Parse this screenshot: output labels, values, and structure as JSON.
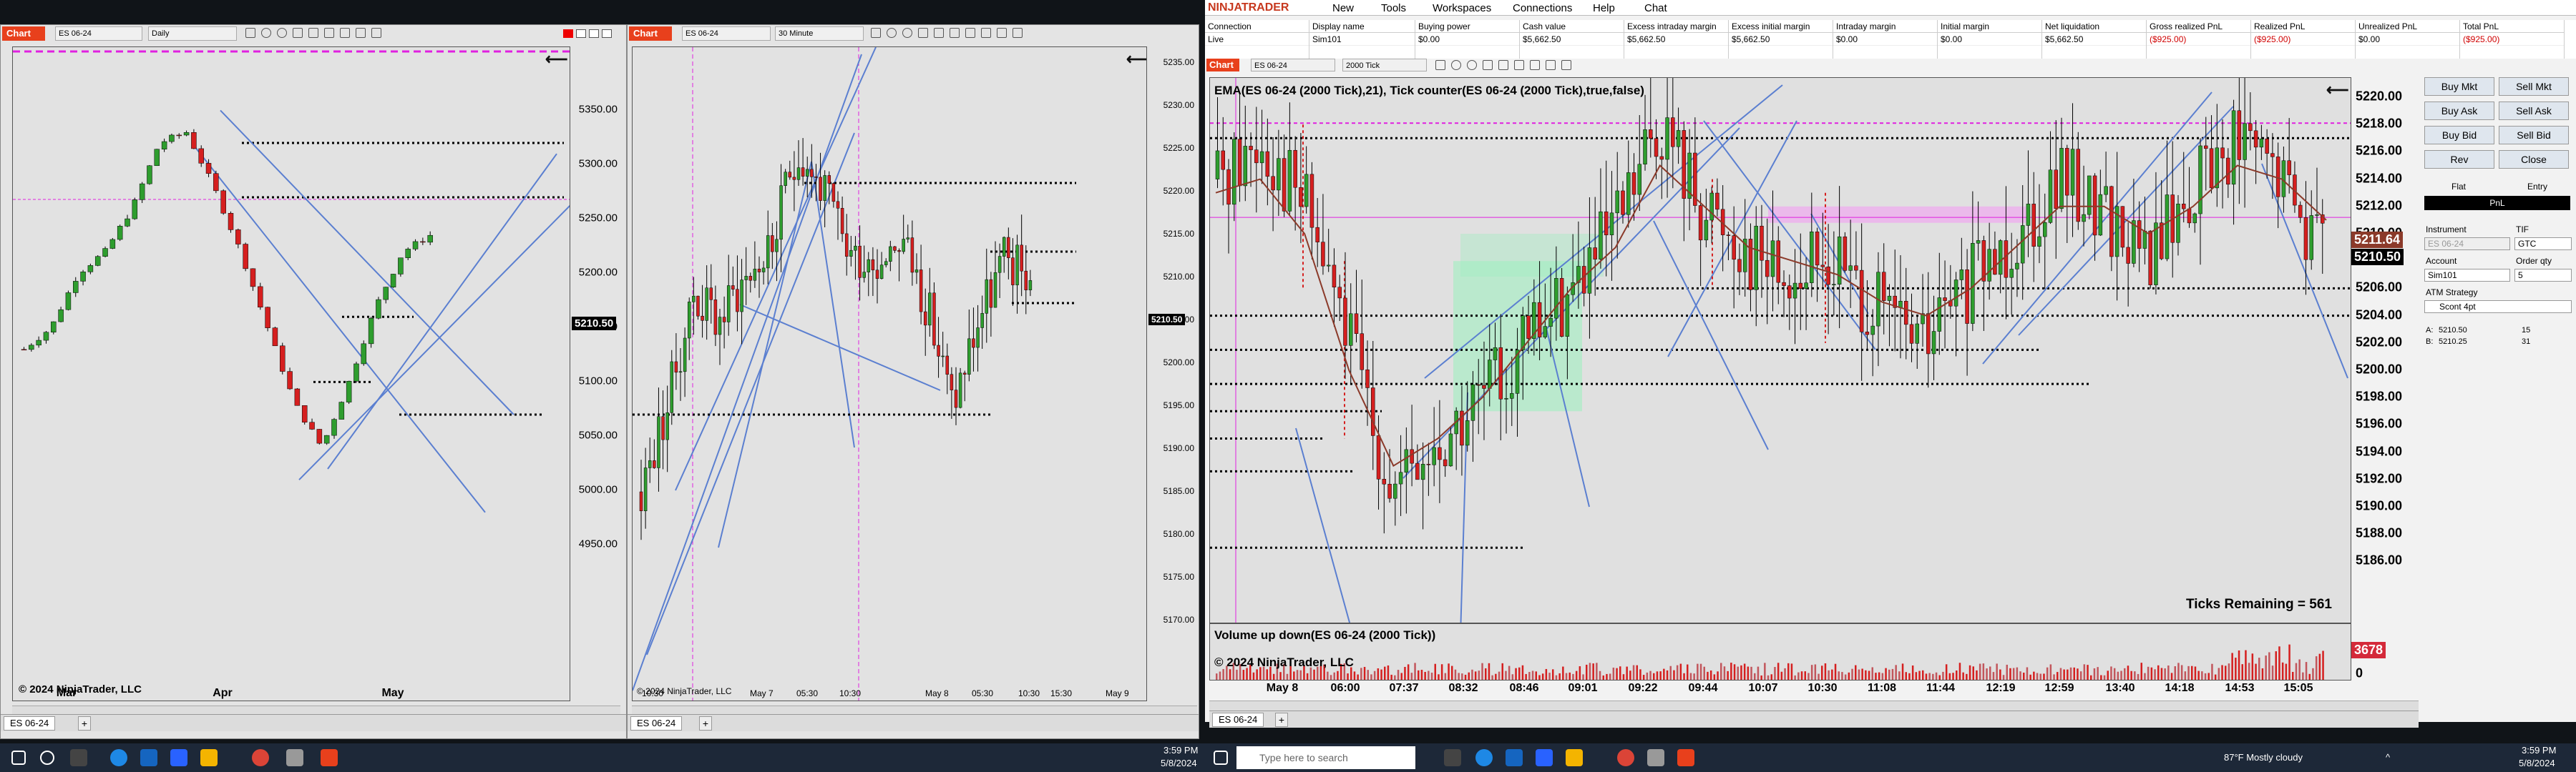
{
  "left_chart": {
    "tab": "Chart",
    "instrument": "ES 06-24",
    "period": "Daily",
    "yticks": [
      "5350.00",
      "5300.00",
      "5250.00",
      "5200.00",
      "5150.00",
      "5100.00",
      "5050.00",
      "5000.00",
      "4950.00"
    ],
    "price": "5210.50",
    "months": [
      "Mar",
      "Apr",
      "May"
    ],
    "copyright": "© 2024 NinjaTrader, LLC",
    "doc_tab": "ES 06-24"
  },
  "mid_chart": {
    "tab": "Chart",
    "instrument": "ES 06-24",
    "period": "30 Minute",
    "yticks": [
      "5235.00",
      "5230.00",
      "5225.00",
      "5220.00",
      "5215.00",
      "5210.00",
      "5205.00",
      "5200.00",
      "5195.00",
      "5190.00",
      "5185.00",
      "5180.00",
      "5175.00",
      "5170.00"
    ],
    "price": "5210.50",
    "xlabels": [
      "10:30",
      "May 7",
      "05:30",
      "10:30",
      "May 8",
      "05:30",
      "10:30",
      "15:30",
      "May 9"
    ],
    "copyright": "© 2024 NinjaTrader, LLC",
    "doc_tab": "ES 06-24"
  },
  "nt": {
    "brand": "NINJATRADER",
    "menu": [
      "New",
      "Tools",
      "Workspaces",
      "Connections",
      "Help",
      "Chat"
    ],
    "account_headers": [
      "Connection",
      "Display name",
      "Buying power",
      "Cash value",
      "Excess intraday margin",
      "Excess initial margin",
      "Intraday margin",
      "Initial margin",
      "Net liquidation",
      "Gross realized PnL",
      "Realized PnL",
      "Unrealized PnL",
      "Total PnL"
    ],
    "account_row": [
      "Live",
      "Sim101",
      "$0.00",
      "$5,662.50",
      "$5,662.50",
      "$5,662.50",
      "$0.00",
      "$0.00",
      "$5,662.50",
      "($925.00)",
      "($925.00)",
      "$0.00",
      "($925.00)"
    ],
    "chart_tab": "Chart",
    "instrument": "ES 06-24",
    "period": "2000 Tick",
    "indicator_title": "EMA(ES 06-24 (2000 Tick),21), Tick counter(ES 06-24 (2000 Tick),true,false)",
    "yticks": [
      "5220.00",
      "5218.00",
      "5216.00",
      "5214.00",
      "5212.00",
      "5210.00",
      "5208.00",
      "5206.00",
      "5204.00",
      "5202.00",
      "5200.00",
      "5198.00",
      "5196.00",
      "5194.00",
      "5192.00",
      "5190.00",
      "5188.00",
      "5186.00"
    ],
    "price_a": "5211.64",
    "price_b": "5210.50",
    "ticks_remaining": "Ticks Remaining = 561",
    "volume_title": "Volume up down(ES 06-24 (2000 Tick))",
    "copyright": "© 2024 NinjaTrader, LLC",
    "volume": "3678",
    "volume_zero": "0",
    "xlabels": [
      "May 8",
      "06:00",
      "07:37",
      "08:32",
      "08:46",
      "09:01",
      "09:22",
      "09:44",
      "10:07",
      "10:30",
      "11:08",
      "11:44",
      "12:19",
      "12:59",
      "13:40",
      "14:18",
      "14:53",
      "15:05"
    ],
    "doc_tab": "ES 06-24",
    "order": {
      "buy_mkt": "Buy Mkt",
      "sell_mkt": "Sell Mkt",
      "buy_ask": "Buy Ask",
      "sell_ask": "Sell Ask",
      "buy_bid": "Buy Bid",
      "sell_bid": "Sell Bid",
      "rev": "Rev",
      "close": "Close",
      "flat": "Flat",
      "entry": "Entry",
      "pnl": "PnL",
      "instrument_label": "Instrument",
      "tif_label": "TIF",
      "tif": "GTC",
      "account_label": "Account",
      "qty_label": "Order qty",
      "account": "Sim101",
      "qty": "5",
      "atm_label": "ATM Strategy",
      "atm": "Scont 4pt",
      "a_label": "A:",
      "a_price": "5210.50",
      "a_size": "15",
      "b_label": "B:",
      "b_price": "5210.25",
      "b_size": "31"
    }
  },
  "taskbar": {
    "time_left": "3:59 PM",
    "date_left": "5/8/2024",
    "search_placeholder": "Type here to search",
    "weather": "87°F  Mostly cloudy",
    "time_right": "3:59 PM",
    "date_right": "5/8/2024"
  }
}
